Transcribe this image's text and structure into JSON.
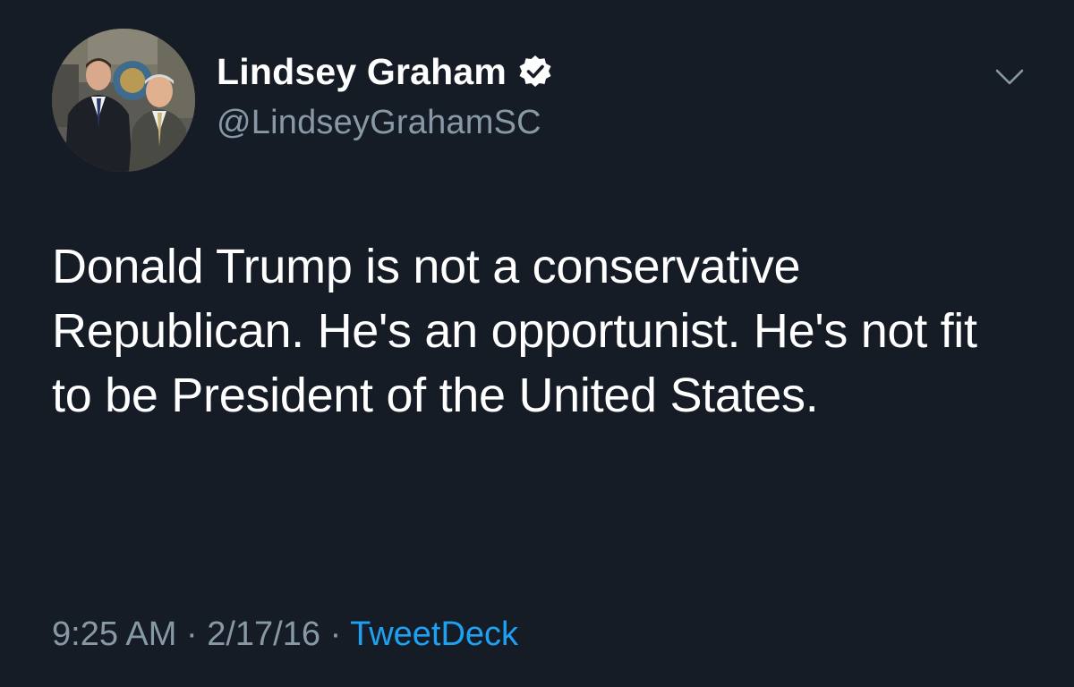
{
  "author": {
    "display_name": "Lindsey Graham",
    "handle": "@LindseyGrahamSC",
    "verified": true,
    "avatar_icon": "profile-photo"
  },
  "tweet": {
    "text": "Donald Trump is not a conservative Republican. He's an opportunist. He's not fit to be President of the United States."
  },
  "meta": {
    "time": "9:25 AM",
    "separator": "·",
    "date": "2/17/16",
    "source": "TweetDeck"
  },
  "icons": {
    "verified": "verified-badge-icon",
    "menu": "chevron-down-icon"
  },
  "colors": {
    "background": "#161c26",
    "text": "#ffffff",
    "secondary_text": "#8899a6",
    "link": "#1da1f2"
  }
}
